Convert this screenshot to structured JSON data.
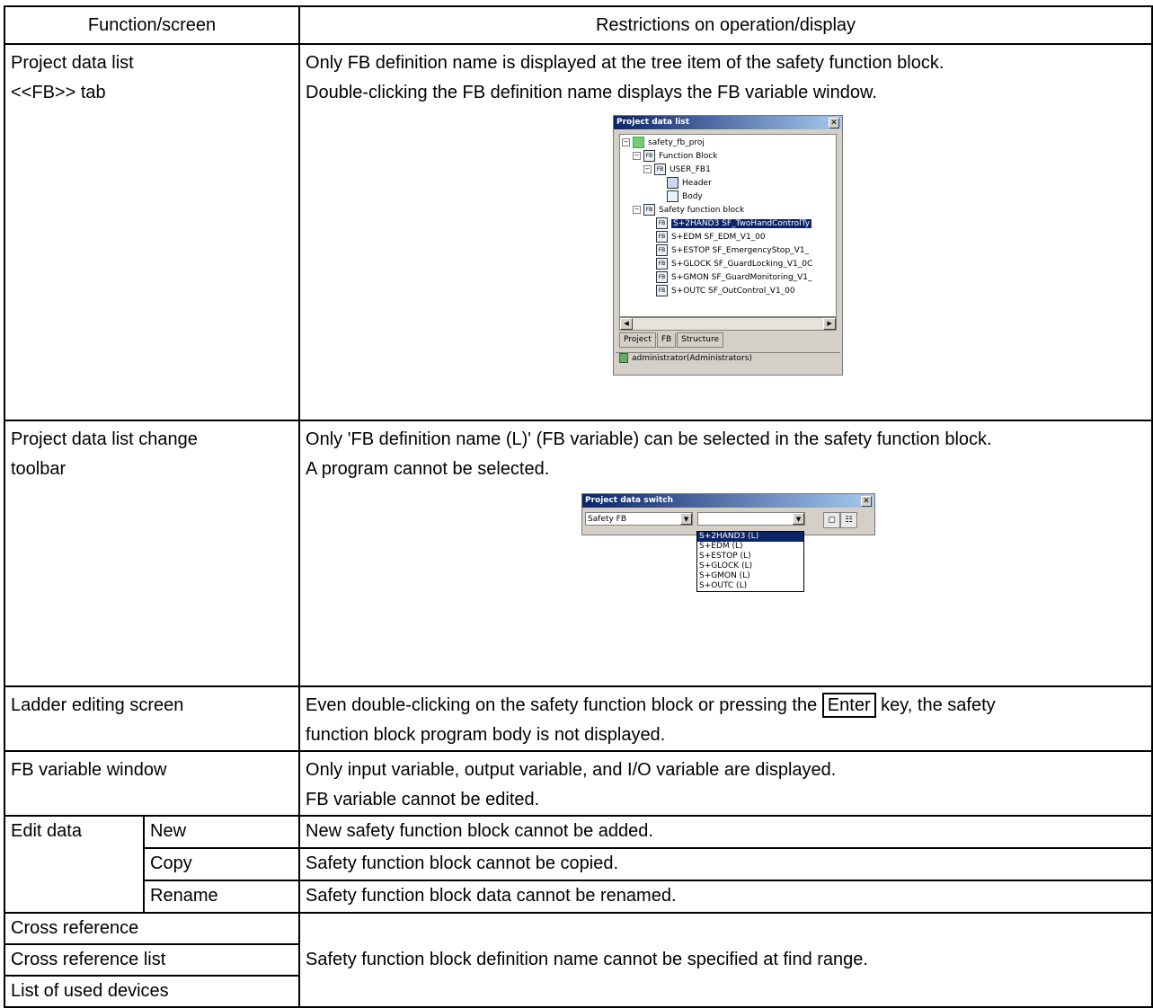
{
  "table": {
    "header": {
      "col1": "Function/screen",
      "col2": "Restrictions on operation/display"
    },
    "rows": {
      "project_data_list": {
        "function_lines": [
          "Project data list",
          "<<FB>> tab"
        ],
        "restriction_lines": [
          "Only FB definition name is displayed at the tree item of the safety function block.",
          "Double-clicking the FB definition name displays the FB variable window."
        ]
      },
      "change_toolbar": {
        "function_lines": [
          "Project data list change",
          "toolbar"
        ],
        "restriction_lines": [
          "Only 'FB definition name (L)' (FB variable) can be selected in the safety function block.",
          "A program cannot be selected."
        ]
      },
      "ladder": {
        "function": "Ladder editing screen",
        "restriction_before": "Even double-clicking on the safety function block or pressing the",
        "key": "Enter",
        "restriction_after": "key, the safety",
        "restriction_line2": "function block program body is not displayed."
      },
      "fb_variable": {
        "function": "FB variable window",
        "restriction_lines": [
          "Only input variable, output variable, and I/O variable are displayed.",
          "FB variable cannot be edited."
        ]
      },
      "edit_data": {
        "function": "Edit data",
        "items": [
          {
            "sub": "New",
            "restriction": "New safety function block cannot be added."
          },
          {
            "sub": "Copy",
            "restriction": "Safety function block cannot be copied."
          },
          {
            "sub": "Rename",
            "restriction": "Safety function block data cannot be renamed."
          }
        ]
      },
      "cross": {
        "functions": [
          "Cross reference",
          "Cross reference list",
          "List of used devices"
        ],
        "restriction": "Safety function block definition name cannot be specified at find range."
      }
    }
  },
  "project_window": {
    "title": "Project data list",
    "tree": {
      "root": "safety_fb_proj",
      "function_block": "Function Block",
      "user_fb": "USER_FB1",
      "header": "Header",
      "body": "Body",
      "safety_fb": "Safety function block",
      "items": [
        "S+2HAND3 SF_TwoHandControlTy",
        "S+EDM SF_EDM_V1_00",
        "S+ESTOP SF_EmergencyStop_V1_",
        "S+GLOCK SF_GuardLocking_V1_0C",
        "S+GMON SF_GuardMonitoring_V1_",
        "S+OUTC SF_OutControl_V1_00"
      ]
    },
    "tabs": [
      "Project",
      "FB",
      "Structure"
    ],
    "active_tab": "FB",
    "status": "administrator(Administrators)"
  },
  "switch_window": {
    "title": "Project data switch",
    "combo1_value": "Safety FB",
    "combo2_value": "",
    "options": [
      "S+2HAND3 (L)",
      "S+EDM (L)",
      "S+ESTOP (L)",
      "S+GLOCK (L)",
      "S+GMON (L)",
      "S+OUTC (L)"
    ],
    "selected_index": 0
  }
}
